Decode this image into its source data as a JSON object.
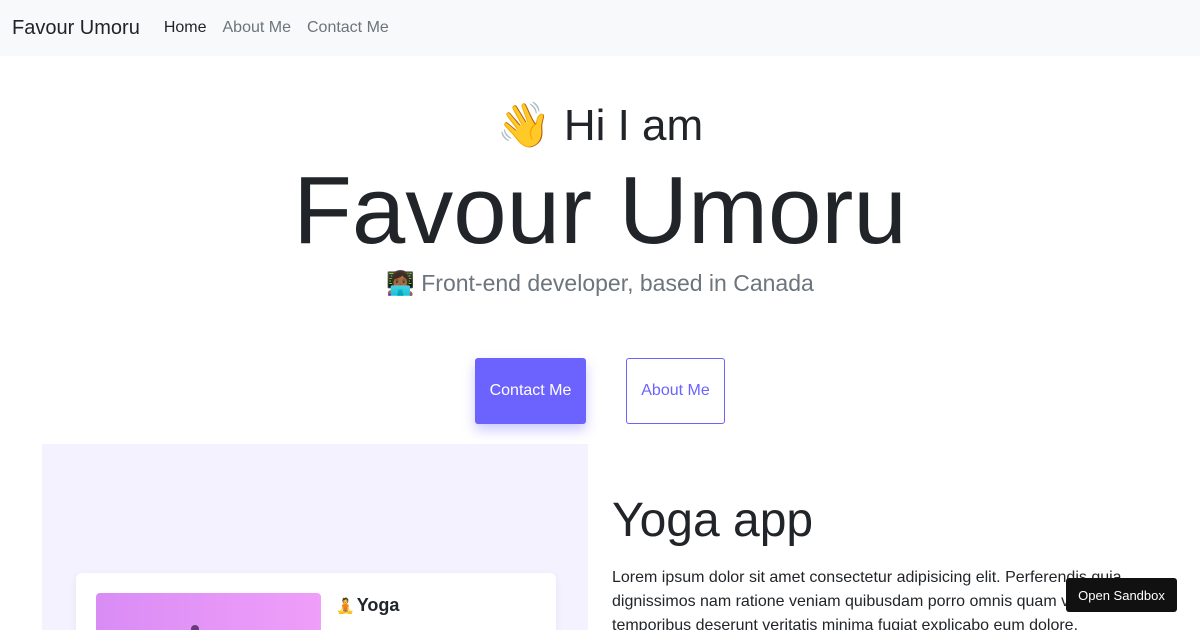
{
  "navbar": {
    "brand": "Favour Umoru",
    "links": [
      "Home",
      "About Me",
      "Contact Me"
    ],
    "active": "Home"
  },
  "hero": {
    "greeting": "👋 Hi I am",
    "name": "Favour Umoru",
    "tagline": "👩🏾‍💻 Front-end developer, based in Canada"
  },
  "buttons": {
    "contact": "Contact Me",
    "about": "About Me"
  },
  "project": {
    "title": "Yoga app",
    "description": "Lorem ipsum dolor sit amet consectetur adipisicing elit. Perferendis quia dignissimos nam ratione veniam quibusdam porro omnis quam ve alias temporibus deserunt veritatis minima fugiat explicabo eum dolore.",
    "preview_title": "Yoga",
    "preview_icon": "🧘"
  },
  "sandbox": {
    "label": "Open Sandbox"
  },
  "colors": {
    "accent": "#6c63ff",
    "navbar_bg": "#f8f9fa",
    "preview_bg": "#f4f2fe"
  }
}
